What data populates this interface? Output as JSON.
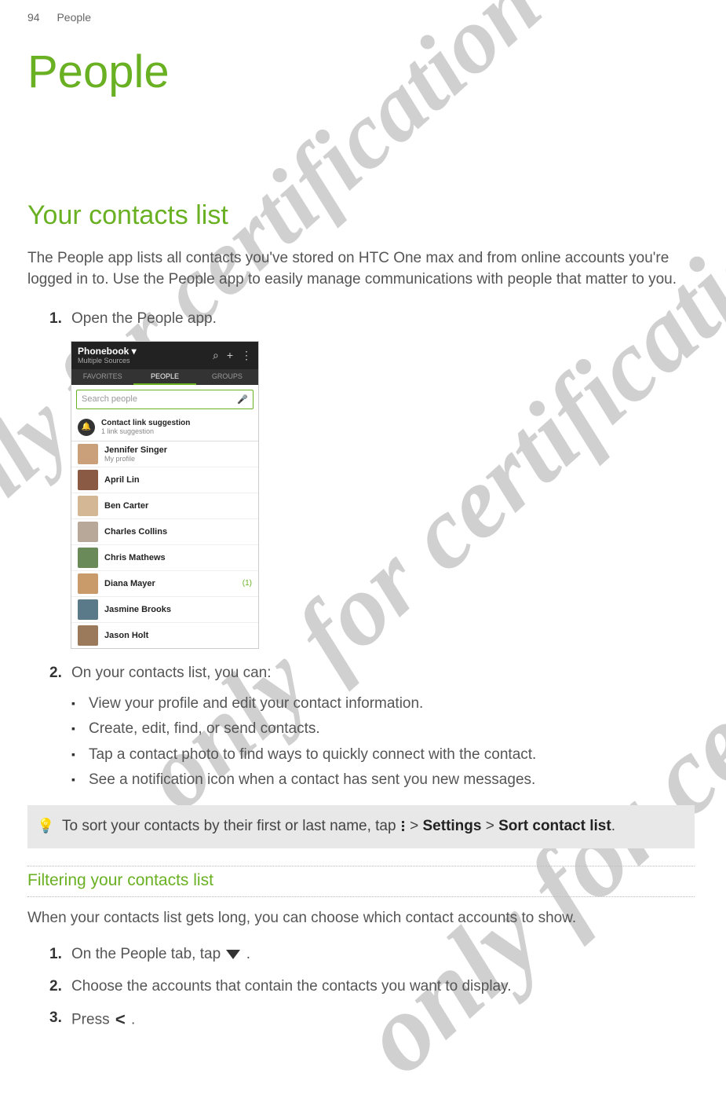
{
  "header": {
    "page_number": "94",
    "section": "People"
  },
  "title": "People",
  "section_heading": "Your contacts list",
  "intro": "The People app lists all contacts you've stored on HTC One max and from online accounts you're logged in to. Use the People app to easily manage communications with people that matter to you.",
  "steps": {
    "s1": {
      "num": "1.",
      "text": "Open the People app."
    },
    "s2": {
      "num": "2.",
      "text": "On your contacts list, you can:"
    }
  },
  "bullets": {
    "b1": "View your profile and edit your contact information.",
    "b2": "Create, edit, find, or send contacts.",
    "b3": "Tap a contact photo to find ways to quickly connect with the contact.",
    "b4": "See a notification icon when a contact has sent you new messages."
  },
  "tip": {
    "pre": "To sort your contacts by their first or last name, tap ",
    "mid1": " > ",
    "settings": "Settings",
    "mid2": " > ",
    "sort": "Sort contact list",
    "post": "."
  },
  "subsection_heading": "Filtering your contacts list",
  "filter_intro": "When your contacts list gets long, you can choose which contact accounts to show.",
  "filter_steps": {
    "f1": {
      "num": "1.",
      "pre": "On the People tab, tap ",
      "post": "."
    },
    "f2": {
      "num": "2.",
      "text": "Choose the accounts that contain the contacts you want to display."
    },
    "f3": {
      "num": "3.",
      "pre": "Press ",
      "post": "."
    }
  },
  "screenshot": {
    "header_title": "Phonebook ▾",
    "header_sub": "Multiple Sources",
    "tabs": {
      "t1": "FAVORITES",
      "t2": "PEOPLE",
      "t3": "GROUPS"
    },
    "search_placeholder": "Search people",
    "link_suggestion": {
      "title": "Contact link suggestion",
      "sub": "1 link suggestion"
    },
    "contacts": {
      "c0": {
        "name": "Jennifer Singer",
        "sub": "My profile"
      },
      "c1": {
        "name": "April Lin"
      },
      "c2": {
        "name": "Ben Carter"
      },
      "c3": {
        "name": "Charles Collins"
      },
      "c4": {
        "name": "Chris Mathews"
      },
      "c5": {
        "name": "Diana Mayer",
        "count": "(1)"
      },
      "c6": {
        "name": "Jasmine Brooks"
      },
      "c7": {
        "name": "Jason Holt"
      }
    }
  },
  "watermark": "only for certification"
}
